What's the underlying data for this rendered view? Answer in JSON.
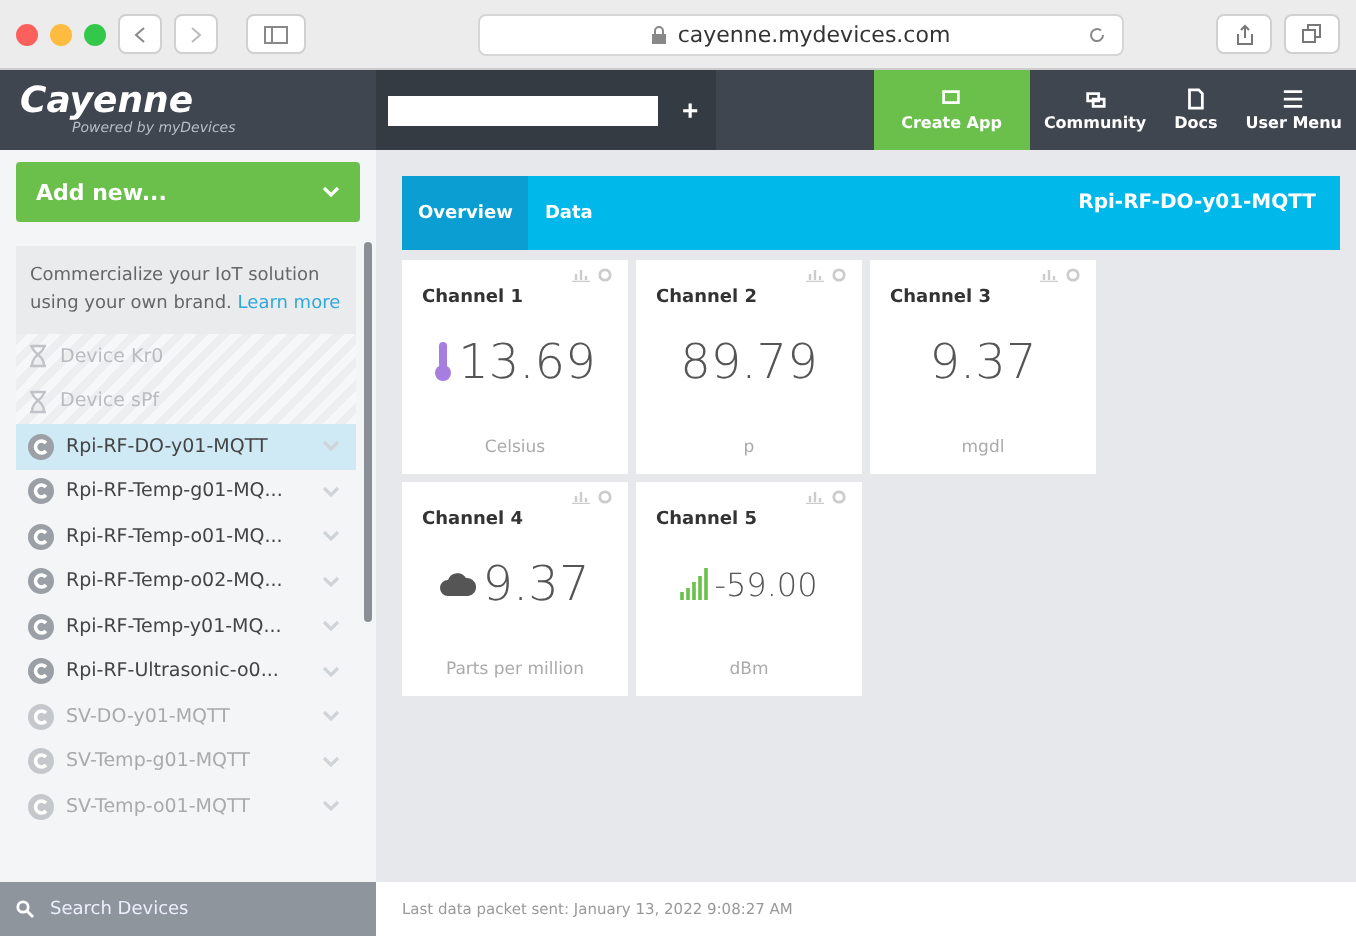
{
  "browser": {
    "url": "cayenne.mydevices.com"
  },
  "header": {
    "logo": "Cayenne",
    "tagline": "Powered by myDevices",
    "add_tab": "+",
    "actions": [
      {
        "label": "Create App",
        "kind": "app",
        "selected": true
      },
      {
        "label": "Community",
        "kind": "community",
        "selected": false
      },
      {
        "label": "Docs",
        "kind": "docs",
        "selected": false
      },
      {
        "label": "User Menu",
        "kind": "menu",
        "selected": false
      }
    ]
  },
  "sidebar": {
    "add_button": "Add new...",
    "promo": {
      "text": "Commercialize your IoT solution using your own brand.",
      "link": "Learn more"
    },
    "devices": [
      {
        "name": "Device Kr0",
        "kind": "pending",
        "selected": false
      },
      {
        "name": "Device sPf",
        "kind": "pending",
        "selected": false
      },
      {
        "name": "Rpi-RF-DO-y01-MQTT",
        "kind": "device",
        "selected": true,
        "online": true
      },
      {
        "name": "Rpi-RF-Temp-g01-MQ...",
        "kind": "device",
        "selected": false,
        "online": true
      },
      {
        "name": "Rpi-RF-Temp-o01-MQ...",
        "kind": "device",
        "selected": false,
        "online": true
      },
      {
        "name": "Rpi-RF-Temp-o02-MQ...",
        "kind": "device",
        "selected": false,
        "online": true
      },
      {
        "name": "Rpi-RF-Temp-y01-MQ...",
        "kind": "device",
        "selected": false,
        "online": true
      },
      {
        "name": "Rpi-RF-Ultrasonic-o0...",
        "kind": "device",
        "selected": false,
        "online": true
      },
      {
        "name": "SV-DO-y01-MQTT",
        "kind": "device",
        "selected": false,
        "online": false
      },
      {
        "name": "SV-Temp-g01-MQTT",
        "kind": "device",
        "selected": false,
        "online": false
      },
      {
        "name": "SV-Temp-o01-MQTT",
        "kind": "device",
        "selected": false,
        "online": false
      }
    ],
    "search": {
      "placeholder": "Search Devices"
    }
  },
  "dashboard": {
    "tabs": [
      {
        "label": "Overview",
        "selected": true
      },
      {
        "label": "Data",
        "selected": false
      }
    ],
    "device_title": "Rpi-RF-DO-y01-MQTT",
    "widgets": [
      {
        "title": "Channel 1",
        "value": "13.69",
        "unit": "Celsius",
        "kind": "thermometer"
      },
      {
        "title": "Channel 2",
        "value": "89.79",
        "unit": "p",
        "kind": "plain"
      },
      {
        "title": "Channel 3",
        "value": "9.37",
        "unit": "mgdl",
        "kind": "plain"
      },
      {
        "title": "Channel 4",
        "value": "9.37",
        "unit": "Parts per million",
        "kind": "co2"
      },
      {
        "title": "Channel 5",
        "value": "-59.00",
        "unit": "dBm",
        "kind": "signal"
      }
    ],
    "status": "Last data packet sent: January 13, 2022 9:08:27 AM"
  }
}
